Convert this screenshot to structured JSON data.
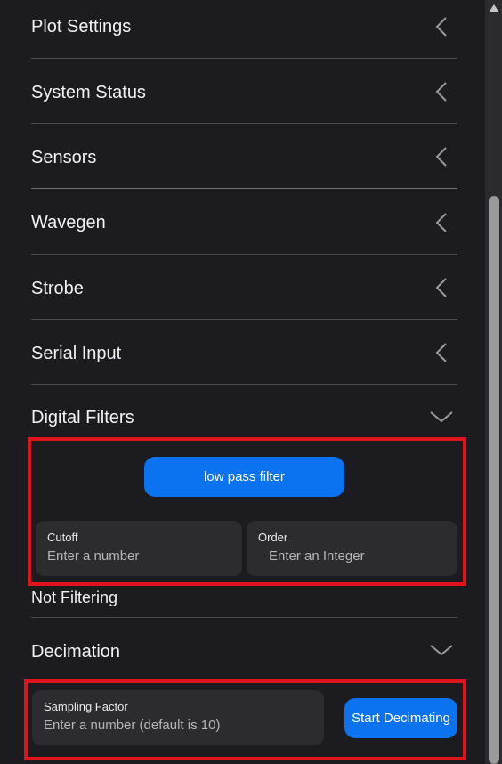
{
  "sections": [
    {
      "title": "Plot Settings",
      "state": "collapsed"
    },
    {
      "title": "System Status",
      "state": "collapsed"
    },
    {
      "title": "Sensors",
      "state": "collapsed"
    },
    {
      "title": "Wavegen",
      "state": "collapsed"
    },
    {
      "title": "Strobe",
      "state": "collapsed"
    },
    {
      "title": "Serial Input",
      "state": "collapsed"
    },
    {
      "title": "Digital Filters",
      "state": "expanded"
    },
    {
      "title": "Decimation",
      "state": "expanded"
    }
  ],
  "digital_filters": {
    "filter_type_button": "low pass filter",
    "cutoff": {
      "label": "Cutoff",
      "placeholder": "Enter a number",
      "value": ""
    },
    "order": {
      "label": "Order",
      "placeholder": "Enter an Integer",
      "value": ""
    },
    "status": "Not Filtering"
  },
  "decimation": {
    "sampling_factor": {
      "label": "Sampling Factor",
      "placeholder": "Enter a number (default is 10)",
      "value": ""
    },
    "start_button": "Start Decimating"
  },
  "colors": {
    "background": "#1c1b1f",
    "accent": "#0b72f0",
    "highlight_box": "#e0141b",
    "field_bg": "#2c2b30"
  },
  "icons": {
    "collapsed": "chevron-left-icon",
    "expanded": "chevron-down-icon"
  }
}
